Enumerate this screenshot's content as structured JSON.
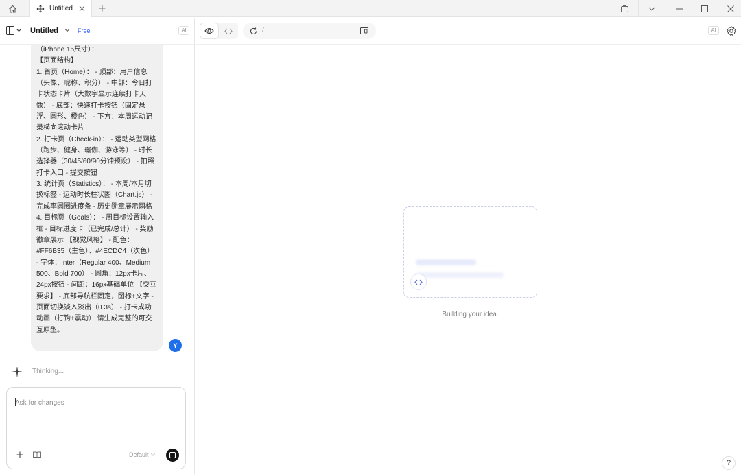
{
  "window": {
    "tab_title": "Untitled",
    "icons": {
      "home": "home-icon",
      "tab": "move-icon",
      "close": "close-icon",
      "add": "plus-icon",
      "right": [
        "tab-overview-icon",
        "chevron-down-icon",
        "minimize-icon",
        "maximize-icon",
        "close-icon"
      ]
    }
  },
  "left_header": {
    "project_name": "Untitled",
    "plan_badge": "Free",
    "ai_badge": "AI"
  },
  "chat": {
    "user_message": "（iPhone 15尺寸）：\n【页面结构】\n1. 首页（Home）： - 顶部：用户信息（头像、昵称、积分） - 中部：今日打卡状态卡片（大数字显示连续打卡天数） - 底部：快速打卡按钮（固定悬浮、圆形、橙色） - 下方：本周运动记录横向滚动卡片\n2. 打卡页（Check-in）： - 运动类型网格（跑步、健身、瑜伽、游泳等） - 时长选择器（30/45/60/90分钟预设） - 拍照打卡入口 - 提交按钮\n3. 统计页（Statistics）： - 本周/本月切换标签 - 运动时长柱状图（Chart.js） - 完成率圆圈进度条 - 历史勋章展示网格\n4. 目标页（Goals）： - 周目标设置输入框 - 目标进度卡（已完成/总计） - 奖励徽章展示 【视觉风格】 - 配色：#FF6B35（主色）、#4ECDC4（次色） - 字体：Inter（Regular 400、Medium 500、Bold 700） - 圆角：12px卡片、24px按钮 - 间距：16px基础单位 【交互要求】 - 底部导航栏固定，图标+文字 - 页面切换淡入淡出（0.3s） - 打卡成功动画（打钩+震动） 请生成完整的可交互原型。",
    "user_avatar": "Y",
    "status": "Thinking..."
  },
  "composer": {
    "placeholder": "Ask for changes",
    "value": "",
    "model": "Default"
  },
  "preview_header": {
    "url": "/",
    "ai_badge": "AI"
  },
  "preview": {
    "status": "Building your idea.",
    "help": "?"
  },
  "colors": {
    "accent": "#3a63f5",
    "avatar": "#1f6feb",
    "stop_button": "#141414"
  }
}
